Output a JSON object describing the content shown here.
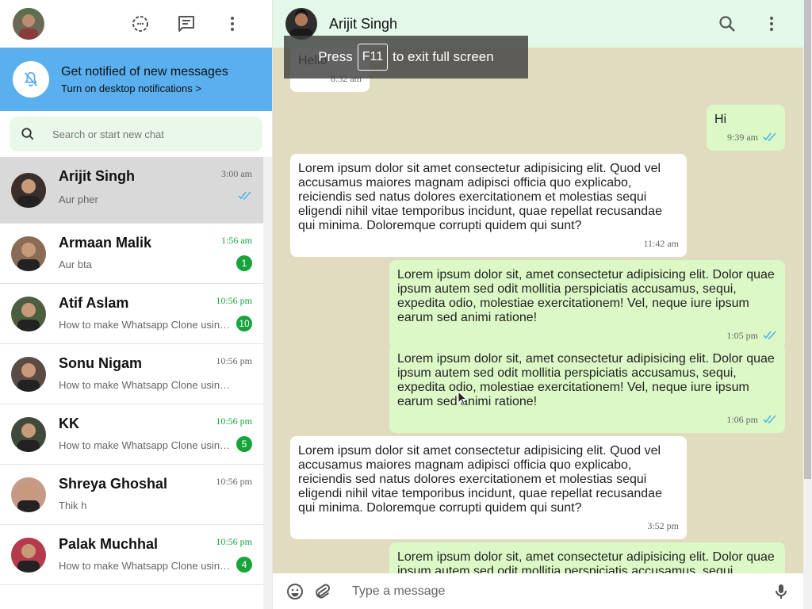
{
  "sidebar": {
    "notification": {
      "title": "Get notified of new messages",
      "subtitle": "Turn on desktop notifications >"
    },
    "search": {
      "placeholder": "Search or start new chat"
    },
    "chats": [
      {
        "name": "Arijit Singh",
        "last": "Aur pher",
        "time": "3:00 am",
        "badge": "",
        "read": true
      },
      {
        "name": "Armaan Malik",
        "last": "Aur bta",
        "time": "1:56 am",
        "badge": "1",
        "read": false
      },
      {
        "name": "Atif Aslam",
        "last": "How to make Whatsapp Clone using React JS",
        "time": "10:56 pm",
        "badge": "10",
        "read": false
      },
      {
        "name": "Sonu Nigam",
        "last": "How to make Whatsapp Clone using React JS",
        "time": "10:56 pm",
        "badge": "",
        "read": false
      },
      {
        "name": "KK",
        "last": "How to make Whatsapp Clone using React JS",
        "time": "10:56 pm",
        "badge": "5",
        "read": false
      },
      {
        "name": "Shreya Ghoshal",
        "last": "Thik h",
        "time": "10:56 pm",
        "badge": "",
        "read": false
      },
      {
        "name": "Palak Muchhal",
        "last": "How to make Whatsapp Clone using React JS",
        "time": "10:56 pm",
        "badge": "4",
        "read": false
      }
    ]
  },
  "conversation": {
    "title": "Arijit Singh",
    "messages": [
      {
        "dir": "in",
        "text": "Hello",
        "time": "8:32 am"
      },
      {
        "dir": "out",
        "text": "Hi",
        "time": "9:39 am"
      },
      {
        "dir": "in",
        "text": "Lorem ipsum dolor sit amet consectetur adipisicing elit. Quod vel accusamus maiores magnam adipisci officia quo explicabo, reiciendis sed natus dolores exercitationem et molestias sequi eligendi nihil vitae temporibus incidunt, quae repellat recusandae qui minima. Doloremque corrupti quidem qui sunt?",
        "time": "11:42 am"
      },
      {
        "dir": "out",
        "text": "Lorem ipsum dolor sit, amet consectetur adipisicing elit. Dolor quae ipsum autem sed odit mollitia perspiciatis accusamus, sequi, expedita odio, molestiae exercitationem! Vel, neque iure ipsum earum sed animi ratione!",
        "time": "1:05 pm"
      },
      {
        "dir": "out",
        "text": "Lorem ipsum dolor sit, amet consectetur adipisicing elit. Dolor quae ipsum autem sed odit mollitia perspiciatis accusamus, sequi, expedita odio, molestiae exercitationem! Vel, neque iure ipsum earum sed animi ratione!",
        "time": "1:06 pm"
      },
      {
        "dir": "in",
        "text": "Lorem ipsum dolor sit amet consectetur adipisicing elit. Quod vel accusamus maiores magnam adipisci officia quo explicabo, reiciendis sed natus dolores exercitationem et molestias sequi eligendi nihil vitae temporibus incidunt, quae repellat recusandae qui minima. Doloremque corrupti quidem qui sunt?",
        "time": "3:52 pm"
      },
      {
        "dir": "out",
        "text": "Lorem ipsum dolor sit, amet consectetur adipisicing elit. Dolor quae ipsum autem sed odit mollitia perspiciatis accusamus, sequi, expedita odio, molestiae exercitationem! Vel, neque iure ipsum earum sed animi ratione!",
        "time": ""
      }
    ]
  },
  "composer": {
    "placeholder": "Type a message"
  },
  "fullscreen_toast": {
    "before": "Press",
    "key": "F11",
    "after": "to exit full screen"
  },
  "colors": {
    "accent_green": "#17a53b",
    "tick_blue": "#4fb6ec",
    "notify_blue": "#5aafef",
    "chat_bg": "#e1dcc0",
    "out_bubble": "#dcf8c6"
  }
}
